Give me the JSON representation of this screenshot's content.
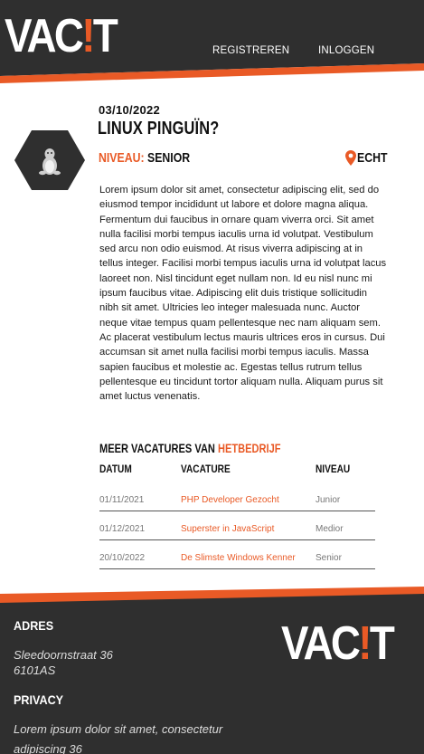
{
  "header": {
    "logo_prefix": "VAC",
    "logo_bang": "!",
    "logo_suffix": "T",
    "nav": {
      "register": "REGISTREREN",
      "login": "INLOGGEN"
    }
  },
  "job": {
    "date": "03/10/2022",
    "title": "LINUX PINGUÏN?",
    "icon": "penguin-icon",
    "level_label": "NIVEAU:",
    "level_value": "SENIOR",
    "location": "ECHT",
    "description": "Lorem ipsum dolor sit amet, consectetur adipiscing elit, sed do eiusmod tempor incididunt ut labore et dolore magna aliqua. Fermentum dui faucibus in ornare quam viverra orci. Sit amet nulla facilisi morbi tempus iaculis urna id volutpat. Vestibulum sed arcu non odio euismod. At risus viverra adipiscing at in tellus integer. Facilisi morbi tempus iaculis urna id volutpat lacus laoreet non. Nisl tincidunt eget nullam non. Id eu nisl nunc mi ipsum faucibus vitae. Adipiscing elit duis tristique sollicitudin nibh sit amet. Ultricies leo integer malesuada nunc. Auctor neque vitae tempus quam pellentesque nec nam aliquam sem. Ac placerat vestibulum lectus mauris ultrices eros in cursus. Dui accumsan sit amet nulla facilisi morbi tempus iaculis. Massa sapien faucibus et molestie ac. Egestas tellus rutrum tellus pellentesque eu tincidunt tortor aliquam nulla. Aliquam purus sit amet luctus venenatis."
  },
  "more": {
    "prefix": "MEER VACATURES VAN",
    "company": "HETBEDRIJF",
    "columns": {
      "date": "DATUM",
      "vacancy": "VACATURE",
      "level": "NIVEAU"
    },
    "rows": [
      {
        "date": "01/11/2021",
        "vacancy": "PHP Developer Gezocht",
        "level": "Junior"
      },
      {
        "date": "01/12/2021",
        "vacancy": "Superster in JavaScript",
        "level": "Medior"
      },
      {
        "date": "20/10/2022",
        "vacancy": "De Slimste Windows Kenner",
        "level": "Senior"
      }
    ]
  },
  "footer": {
    "address_heading": "ADRES",
    "street": "Sleedoornstraat 36",
    "zip": "6101AS",
    "privacy_heading": "PRIVACY",
    "privacy_line1": "Lorem ipsum dolor sit amet, consectetur",
    "privacy_line2": "adipiscing 36"
  },
  "colors": {
    "accent": "#e95a26",
    "dark": "#2f2f2f"
  }
}
